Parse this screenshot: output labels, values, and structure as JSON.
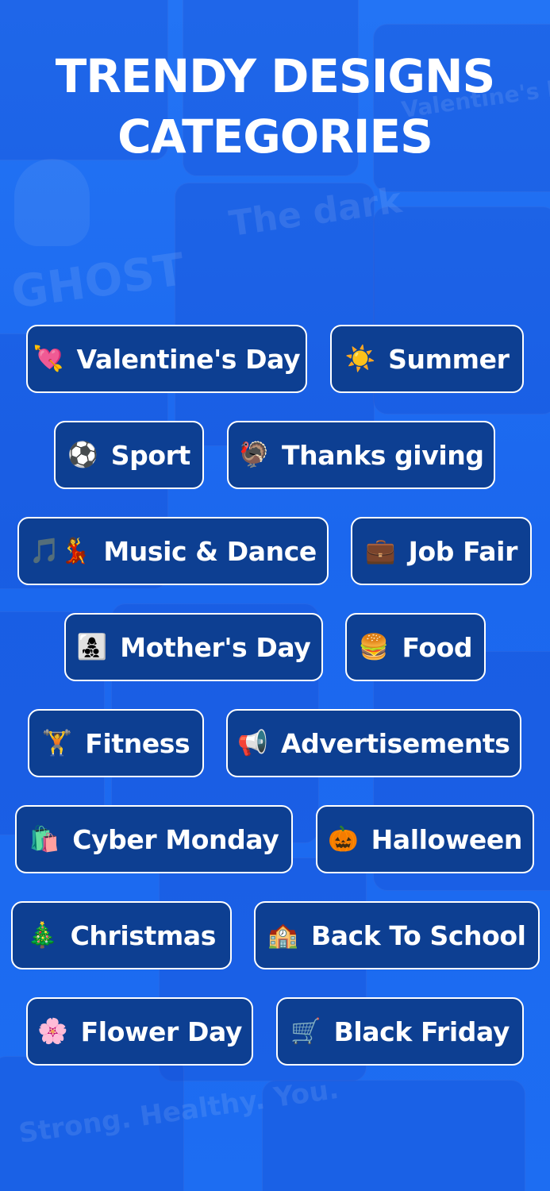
{
  "title": {
    "line1": "TRENDY DESIGNS",
    "line2": "CATEGORIES"
  },
  "categories": [
    {
      "icon": "💘",
      "icon_name": "heart-with-arrow-icon",
      "label": "Valentine's Day"
    },
    {
      "icon": "☀️",
      "icon_name": "sun-icon",
      "label": "Summer"
    },
    {
      "icon": "⚽",
      "icon_name": "soccer-ball-icon",
      "label": "Sport"
    },
    {
      "icon": "🦃",
      "icon_name": "turkey-icon",
      "label": "Thanks giving"
    },
    {
      "icon": "🎵💃",
      "icon_name": "music-dance-icon",
      "label": "Music & Dance"
    },
    {
      "icon": "💼",
      "icon_name": "briefcase-icon",
      "label": "Job Fair"
    },
    {
      "icon": "👩‍👧‍👦",
      "icon_name": "family-icon",
      "label": "Mother's Day"
    },
    {
      "icon": "🍔",
      "icon_name": "burger-icon",
      "label": "Food"
    },
    {
      "icon": "🏋️",
      "icon_name": "weightlifter-icon",
      "label": "Fitness"
    },
    {
      "icon": "📢",
      "icon_name": "megaphone-icon",
      "label": "Advertisements"
    },
    {
      "icon": "🛍️",
      "icon_name": "shopping-bags-icon",
      "label": "Cyber Monday"
    },
    {
      "icon": "🎃",
      "icon_name": "pumpkin-icon",
      "label": "Halloween"
    },
    {
      "icon": "🎄",
      "icon_name": "christmas-tree-icon",
      "label": "Christmas"
    },
    {
      "icon": "🏫",
      "icon_name": "school-icon",
      "label": "Back To School"
    },
    {
      "icon": "🌸",
      "icon_name": "flower-icon",
      "label": "Flower Day"
    },
    {
      "icon": "🛒",
      "icon_name": "shopping-cart-icon",
      "label": "Black Friday"
    }
  ],
  "background_text": [
    "GHOST",
    "The dark",
    "Valentine's DAY",
    "Strong. Healthy. You."
  ],
  "colors": {
    "background": "#1f6bf0",
    "chip_fill": "#0d3f92",
    "chip_border": "#ffffff",
    "text": "#ffffff"
  }
}
